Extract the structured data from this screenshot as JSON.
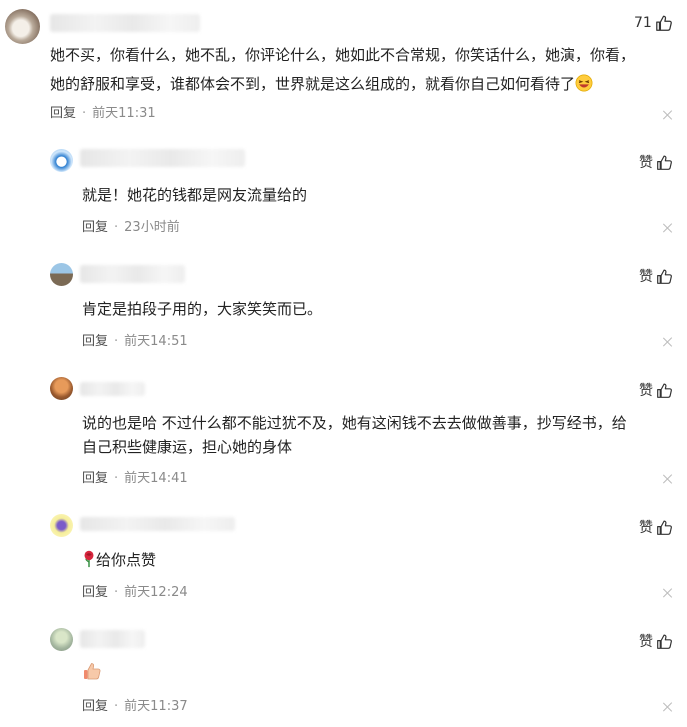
{
  "main_comment": {
    "like_count": "71",
    "text_line1": "她不买，你看什么，她不乱，你评论什么，她如此不合常规，你笑话什么，她演，你看，",
    "text_line2": "她的舒服和享受，谁都体会不到，世界就是这么组成的，就看你自己如何看待了",
    "reply_label": "回复",
    "time": "前天11:31"
  },
  "replies": [
    {
      "like_label": "赞",
      "text": "就是！她花的钱都是网友流量给的",
      "reply_label": "回复",
      "time": "23小时前"
    },
    {
      "like_label": "赞",
      "text": "肯定是拍段子用的，大家笑笑而已。",
      "reply_label": "回复",
      "time": "前天14:51"
    },
    {
      "like_label": "赞",
      "text_line1": "说的也是哈 不过什么都不能过犹不及，她有这闲钱不去去做做善事，抄写经书，给",
      "text_line2": "自己积些健康运，担心她的身体",
      "reply_label": "回复",
      "time": "前天14:41"
    },
    {
      "like_label": "赞",
      "text": "给你点赞",
      "reply_label": "回复",
      "time": "前天12:24"
    },
    {
      "like_label": "赞",
      "text": "",
      "reply_label": "回复",
      "time": "前天11:37"
    }
  ],
  "icons": {
    "thumb": "thumbs-up-outline-icon",
    "close": "close-icon",
    "laugh": "laughing-emoji-icon",
    "rose": "rose-emoji-icon",
    "thumbs_emoji": "thumbs-up-emoji-icon"
  },
  "colors": {
    "text": "#222222",
    "meta": "#8a8a8a",
    "reply_link": "#505050",
    "divider_icon": "#bdbdbd"
  }
}
